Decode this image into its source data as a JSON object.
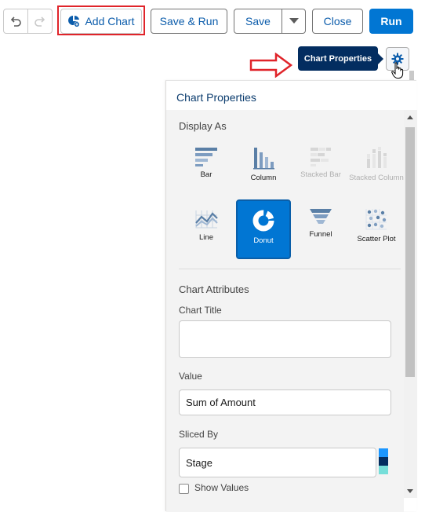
{
  "toolbar": {
    "add_chart": "Add Chart",
    "save_run": "Save & Run",
    "save": "Save",
    "close": "Close",
    "run": "Run",
    "icons": [
      "undo-icon",
      "redo-icon",
      "chart-add-icon",
      "caret-down-icon"
    ]
  },
  "tooltip": {
    "text": "Chart Properties"
  },
  "panel": {
    "title": "Chart Properties",
    "display_as_label": "Display As",
    "chart_types": [
      {
        "label": "Bar",
        "icon": "bar-chart-icon",
        "state": "enabled"
      },
      {
        "label": "Column",
        "icon": "column-chart-icon",
        "state": "enabled"
      },
      {
        "label": "Stacked Bar",
        "icon": "stacked-bar-chart-icon",
        "state": "disabled"
      },
      {
        "label": "Stacked Column",
        "icon": "stacked-column-chart-icon",
        "state": "disabled"
      },
      {
        "label": "Line",
        "icon": "line-chart-icon",
        "state": "enabled"
      },
      {
        "label": "Donut",
        "icon": "donut-chart-icon",
        "state": "selected"
      },
      {
        "label": "Funnel",
        "icon": "funnel-chart-icon",
        "state": "enabled"
      },
      {
        "label": "Scatter Plot",
        "icon": "scatter-plot-icon",
        "state": "enabled"
      }
    ],
    "attributes_label": "Chart Attributes",
    "chart_title_label": "Chart Title",
    "chart_title_value": "",
    "value_label": "Value",
    "value_value": "Sum of Amount",
    "sliced_by_label": "Sliced By",
    "sliced_by_value": "Stage",
    "slice_colors": [
      "#1b96ff",
      "#032d60",
      "#76ded9"
    ],
    "show_values_label": "Show Values",
    "show_values_checked": false
  },
  "colors": {
    "brand": "#0176d3",
    "annotation_red": "#e0242a",
    "tooltip_bg": "#032d60"
  }
}
